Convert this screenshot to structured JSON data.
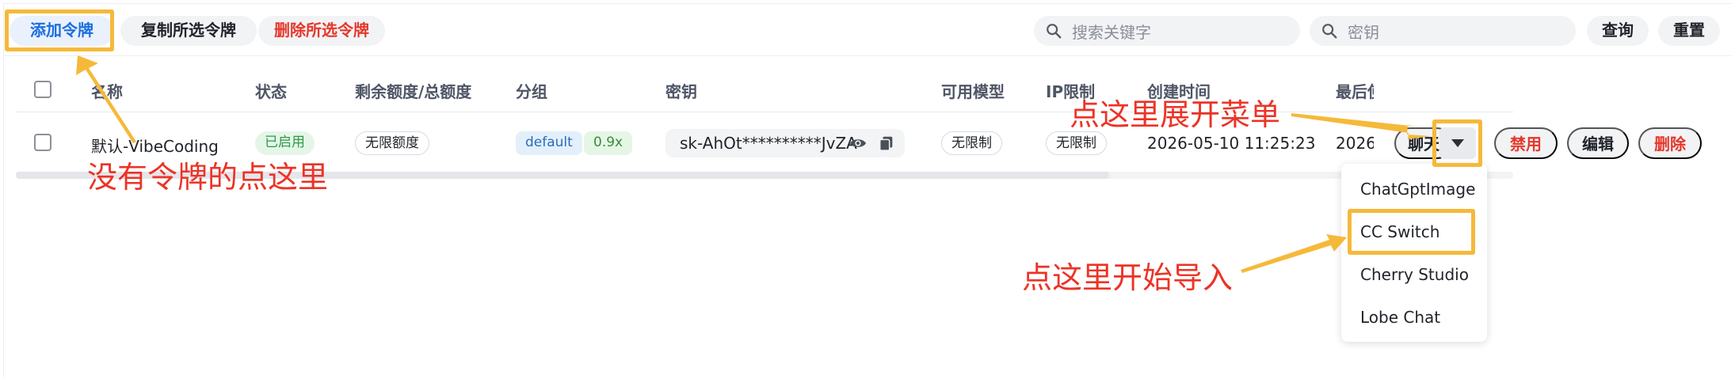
{
  "toolbar": {
    "add_label": "添加令牌",
    "copy_label": "复制所选令牌",
    "delete_label": "删除所选令牌",
    "search_placeholder": "搜索关键字",
    "key_placeholder": "密钥",
    "query_label": "查询",
    "reset_label": "重置"
  },
  "table": {
    "columns": [
      "名称",
      "状态",
      "剩余额度/总额度",
      "分组",
      "密钥",
      "可用模型",
      "IP限制",
      "创建时间",
      "最后使"
    ],
    "rows": [
      {
        "name": "默认-VibeCoding",
        "status": "已启用",
        "quota": "无限额度",
        "group": "default",
        "ratio": "0.9x",
        "key": "sk-AhOt**********JvZA",
        "models": "无限制",
        "ip_limit": "无限制",
        "created": "2026-05-10 11:25:23",
        "last_used": "2026-",
        "actions": {
          "chat": "聊天",
          "disable": "禁用",
          "edit": "编辑",
          "delete": "删除"
        }
      }
    ]
  },
  "menu": {
    "items": [
      "ChatGptImage",
      "CC Switch",
      "Cherry Studio",
      "Lobe Chat"
    ],
    "highlighted": "CC Switch"
  },
  "annotations": {
    "no_token": "没有令牌的点这里",
    "expand_menu": "点这里展开菜单",
    "start_import": "点这里开始导入"
  },
  "colors": {
    "highlight_border": "#f5b93a",
    "annotation_text": "#ec3326",
    "primary_blue": "#1a6fe0",
    "danger_red": "#e5372b"
  }
}
